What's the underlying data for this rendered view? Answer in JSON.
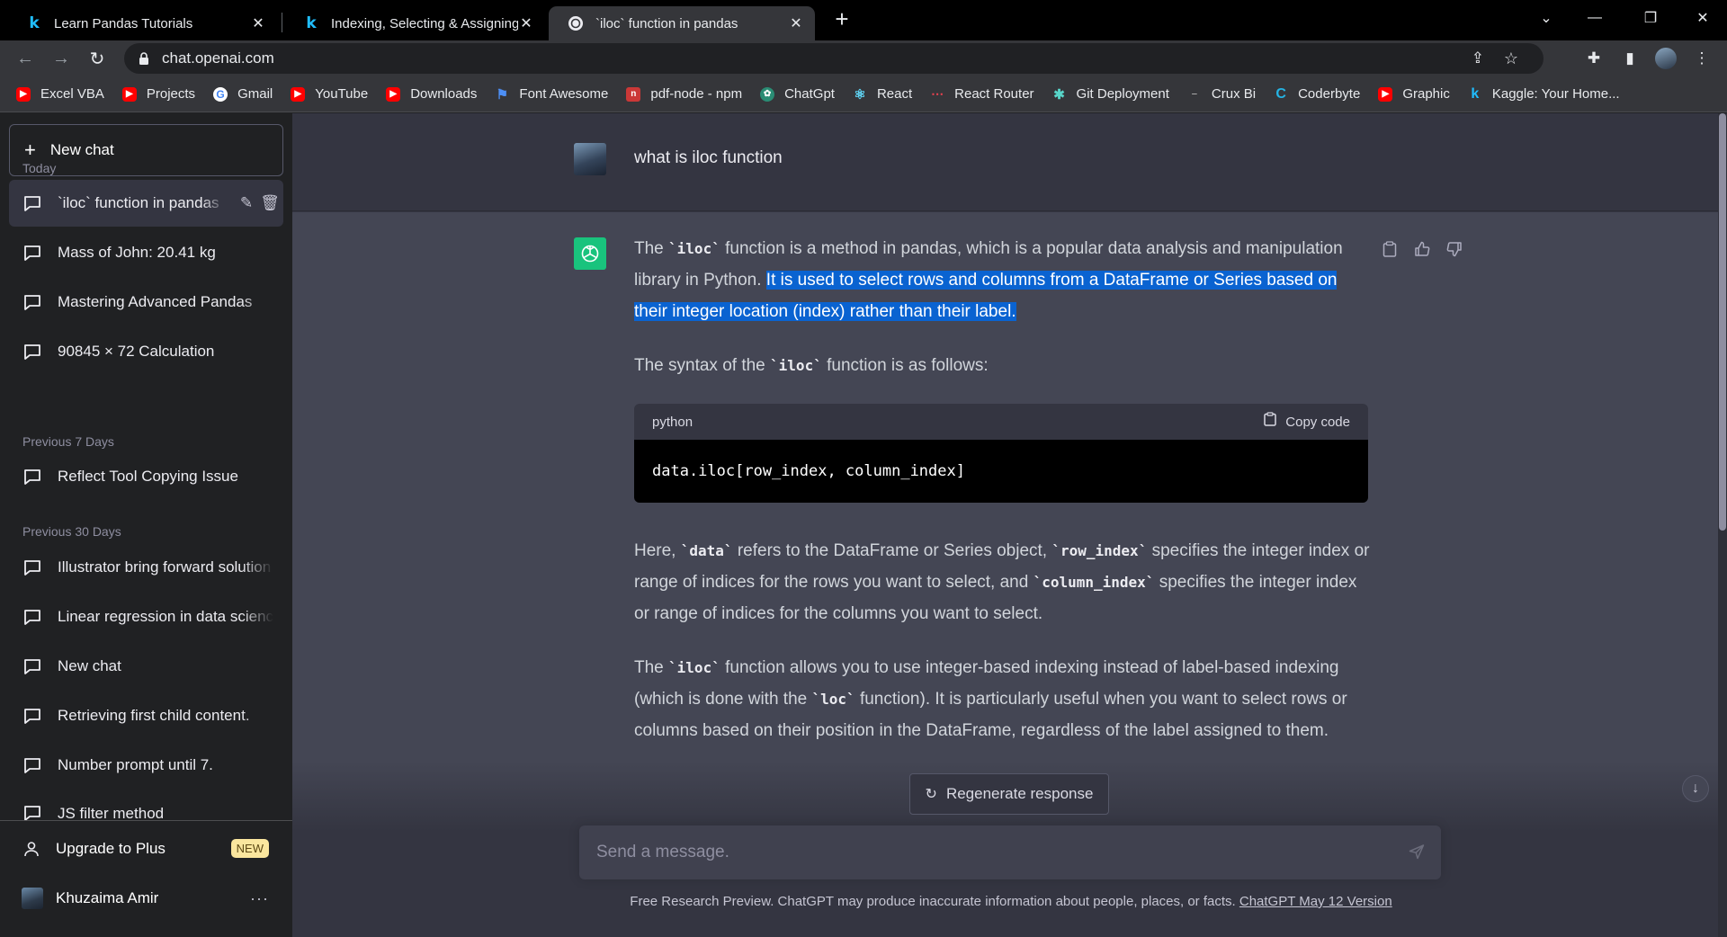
{
  "browser": {
    "tabs": [
      {
        "title": "Learn Pandas Tutorials",
        "icon": "kaggle-icon"
      },
      {
        "title": "Indexing, Selecting & Assigning |",
        "icon": "kaggle-icon"
      },
      {
        "title": "`iloc` function in pandas",
        "icon": "chatgpt-icon",
        "active": true
      }
    ],
    "url": "chat.openai.com",
    "bookmarks": [
      {
        "label": "Excel VBA",
        "icon": "youtube-icon"
      },
      {
        "label": "Projects",
        "icon": "youtube-icon"
      },
      {
        "label": "Gmail",
        "icon": "google-icon"
      },
      {
        "label": "YouTube",
        "icon": "youtube-icon"
      },
      {
        "label": "Downloads",
        "icon": "youtube-icon"
      },
      {
        "label": "Font Awesome",
        "icon": "flag-icon"
      },
      {
        "label": "pdf-node - npm",
        "icon": "npm-icon"
      },
      {
        "label": "ChatGpt",
        "icon": "chatgpt-icon"
      },
      {
        "label": "React",
        "icon": "react-icon"
      },
      {
        "label": "React Router",
        "icon": "react-router-icon"
      },
      {
        "label": "Git Deployment",
        "icon": "git-icon"
      },
      {
        "label": "Crux Bi",
        "icon": "crux-icon"
      },
      {
        "label": "Coderbyte",
        "icon": "coderbyte-icon"
      },
      {
        "label": "Graphic",
        "icon": "youtube-icon"
      },
      {
        "label": "Kaggle: Your Home...",
        "icon": "kaggle-icon"
      }
    ]
  },
  "sidebar": {
    "new_chat": "New chat",
    "sections": {
      "today": "Today",
      "prev7": "Previous 7 Days",
      "prev30": "Previous 30 Days"
    },
    "today": [
      "`iloc` function in pandas",
      "Mass of John: 20.41 kg",
      "Mastering Advanced Pandas",
      "90845 × 72 Calculation"
    ],
    "prev7": [
      "Reflect Tool Copying Issue"
    ],
    "prev30": [
      "Illustrator bring forward solution",
      "Linear regression in data science",
      "New chat",
      "Retrieving first child content.",
      "Number prompt until 7.",
      "JS filter method"
    ],
    "upgrade": "Upgrade to Plus",
    "upgrade_badge": "NEW",
    "user_name": "Khuzaima Amir"
  },
  "chat": {
    "question": "what is iloc function",
    "answer": {
      "p1_a": "The ",
      "p1_code": "`iloc`",
      "p1_b": " function is a method in pandas, which is a popular data analysis and manipulation library in Python. ",
      "p1_hl": "It is used to select rows and columns from a DataFrame or Series based on their integer location (index) rather than their label.",
      "p2_a": "The syntax of the ",
      "p2_code": "`iloc`",
      "p2_b": " function is as follows:",
      "code_lang": "python",
      "copy_label": "Copy code",
      "code": "data.iloc[row_index, column_index]",
      "p3_a": "Here, ",
      "p3_c1": "`data`",
      "p3_b": " refers to the DataFrame or Series object, ",
      "p3_c2": "`row_index`",
      "p3_c": " specifies the integer index or range of indices for the rows you want to select, and ",
      "p3_c3": "`column_index`",
      "p3_d": " specifies the integer index or range of indices for the columns you want to select.",
      "p4_a": "The ",
      "p4_c1": "`iloc`",
      "p4_b": " function allows you to use integer-based indexing instead of label-based indexing (which is done with the ",
      "p4_c2": "`loc`",
      "p4_c": " function). It is particularly useful when you want to select rows or columns based on their position in the DataFrame, regardless of the label assigned to them."
    },
    "regenerate": "Regenerate response",
    "input_placeholder": "Send a message.",
    "footer_text": "Free Research Preview. ChatGPT may produce inaccurate information about people, places, or facts. ",
    "footer_link": "ChatGPT May 12 Version"
  },
  "colors": {
    "accent_green": "#19c37d",
    "selection_blue": "#0a63d1",
    "sidebar_bg": "#202123",
    "main_bg": "#343541",
    "answer_bg": "#444654"
  }
}
